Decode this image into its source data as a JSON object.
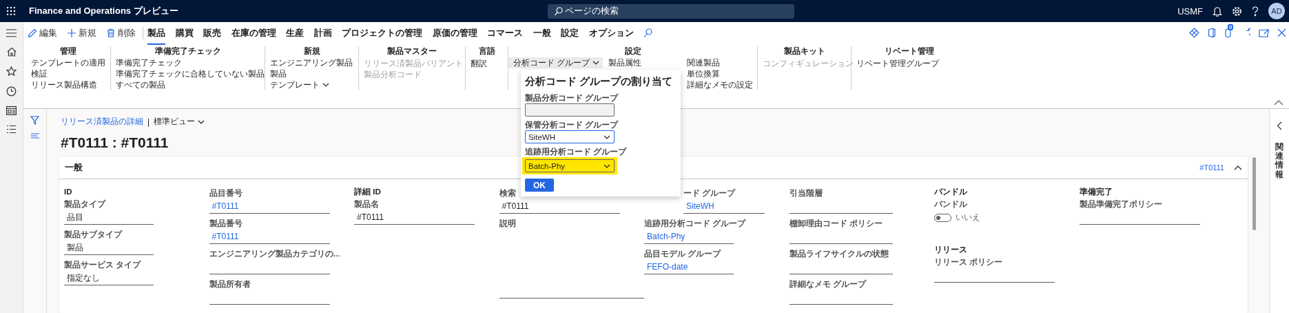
{
  "topbar": {
    "app_title": "Finance and Operations プレビュー",
    "search_placeholder": "ページの検索",
    "company": "USMF",
    "avatar": "AD"
  },
  "actions": [
    {
      "label": "編集",
      "kind": "edit"
    },
    {
      "label": "新規",
      "kind": "new"
    },
    {
      "label": "削除",
      "kind": "delete"
    }
  ],
  "tabs": [
    {
      "label": "製品",
      "selected": true
    },
    {
      "label": "購買",
      "selected": false
    },
    {
      "label": "販売",
      "selected": false
    },
    {
      "label": "在庫の管理",
      "selected": false
    },
    {
      "label": "生産",
      "selected": false
    },
    {
      "label": "計画",
      "selected": false
    },
    {
      "label": "プロジェクトの管理",
      "selected": false
    },
    {
      "label": "原価の管理",
      "selected": false
    },
    {
      "label": "コマース",
      "selected": false
    },
    {
      "label": "一般",
      "selected": false
    },
    {
      "label": "設定",
      "selected": false
    },
    {
      "label": "オプション",
      "selected": false
    }
  ],
  "attachments_badge": "0",
  "ribbon_groups": [
    {
      "title": "管理",
      "columns": [
        [
          {
            "label": "テンプレートの適用",
            "kind": "button",
            "disabled": false
          },
          {
            "label": "検証",
            "kind": "button",
            "disabled": false
          },
          {
            "label": "リリース製品構造",
            "kind": "button",
            "disabled": false
          }
        ]
      ]
    },
    {
      "title": "準備完了チェック",
      "columns": [
        [
          {
            "label": "準備完了チェック",
            "kind": "button",
            "disabled": false
          },
          {
            "label": "準備完了チェックに合格していない製品",
            "kind": "button",
            "disabled": false
          },
          {
            "label": "すべての製品",
            "kind": "button",
            "disabled": false
          }
        ]
      ]
    },
    {
      "title": "新規",
      "columns": [
        [
          {
            "label": "エンジニアリング製品",
            "kind": "button",
            "disabled": false
          },
          {
            "label": "製品",
            "kind": "button",
            "disabled": false
          },
          {
            "label": "テンプレート",
            "kind": "dropdown",
            "disabled": false,
            "expanded": false
          }
        ]
      ]
    },
    {
      "title": "製品マスター",
      "columns": [
        [
          {
            "label": "リリース済製品バリアント",
            "kind": "button",
            "disabled": true
          },
          {
            "label": "製品分析コード",
            "kind": "button",
            "disabled": true
          }
        ]
      ]
    },
    {
      "title": "言語",
      "columns": [
        [
          {
            "label": "翻訳",
            "kind": "button",
            "disabled": false
          }
        ]
      ]
    },
    {
      "title": "設定",
      "columns": [
        [
          {
            "label": "分析コード グループ",
            "kind": "dropdown",
            "disabled": false,
            "expanded": true
          }
        ],
        [
          {
            "label": "製品属性",
            "kind": "button",
            "disabled": false
          }
        ],
        [
          {
            "label": "関連製品",
            "kind": "button",
            "disabled": false
          },
          {
            "label": "単位換算",
            "kind": "button",
            "disabled": false
          },
          {
            "label": "詳細なメモの設定",
            "kind": "button",
            "disabled": false
          }
        ]
      ]
    },
    {
      "title": "製品キット",
      "columns": [
        [
          {
            "label": "コンフィギュレーション",
            "kind": "button",
            "disabled": true
          }
        ]
      ]
    },
    {
      "title": "リベート管理",
      "columns": [
        [
          {
            "label": "リベート管理グループ",
            "kind": "button",
            "disabled": false
          }
        ]
      ]
    }
  ],
  "breadcrumb": {
    "link": "リリース済製品の詳細",
    "separator": "|",
    "view": "標準ビュー"
  },
  "page_title": "#T0111 : #T0111",
  "card": {
    "title": "一般",
    "summary": "#T0111",
    "expanded": true,
    "columns": [
      [
        {
          "kind": "header",
          "label": "ID"
        },
        {
          "kind": "field",
          "label": "製品タイプ",
          "value": "品目",
          "link": false
        },
        {
          "kind": "field",
          "label": "製品サブタイプ",
          "value": "製品",
          "link": false
        },
        {
          "kind": "field",
          "label": "製品サービス タイプ",
          "value": "指定なし",
          "link": false
        }
      ],
      [
        {
          "kind": "field",
          "label": "品目番号",
          "value": "#T0111",
          "link": true
        },
        {
          "kind": "field",
          "label": "製品番号",
          "value": "#T0111",
          "link": true
        },
        {
          "kind": "field",
          "label": "エンジニアリング製品カテゴリの...",
          "link": false
        },
        {
          "kind": "field",
          "label": "製品所有者",
          "link": false
        }
      ],
      [
        {
          "kind": "header",
          "label": "詳細 ID"
        },
        {
          "kind": "field",
          "label": "製品名",
          "value": "#T0111",
          "link": false
        }
      ],
      [
        {
          "kind": "field",
          "label": "検索",
          "value": "#T0111",
          "link": false
        },
        {
          "kind": "multiline",
          "label": "説明"
        }
      ],
      [
        {
          "kind": "field",
          "label": "ード グループ",
          "value": "SiteWH",
          "link": true
        },
        {
          "kind": "field",
          "label": "追跡用分析コード グループ",
          "value": "Batch-Phy",
          "link": true
        },
        {
          "kind": "field",
          "label": "品目モデル グループ",
          "value": "FEFO-date",
          "link": true
        }
      ],
      [
        {
          "kind": "field",
          "label": "引当階層",
          "link": false
        },
        {
          "kind": "field",
          "label": "棚卸理由コード ポリシー",
          "link": false
        },
        {
          "kind": "field",
          "label": "製品ライフサイクルの状態",
          "link": false
        },
        {
          "kind": "field",
          "label": "詳細なメモ グループ",
          "link": false
        }
      ],
      [
        {
          "kind": "header",
          "label": "バンドル"
        },
        {
          "kind": "toggle",
          "label": "バンドル",
          "on": false,
          "value": "いいえ"
        },
        {
          "kind": "header",
          "label": "リリース"
        },
        {
          "kind": "field",
          "label": "リリース ポリシー",
          "link": false
        }
      ],
      [
        {
          "kind": "header",
          "label": "準備完了"
        },
        {
          "kind": "field",
          "label": "製品準備完了ポリシー",
          "link": false
        }
      ]
    ]
  },
  "related_pane": "関連情報",
  "popup": {
    "title": "分析コード グループの割り当て",
    "fields": [
      {
        "label": "製品分析コード グループ",
        "kind": "text",
        "disabled": true,
        "focused": false,
        "highlighted": false
      },
      {
        "label": "保管分析コード グループ",
        "kind": "combo",
        "value": "SiteWH",
        "disabled": false,
        "focused": true,
        "highlighted": false
      },
      {
        "label": "追跡用分析コード グループ",
        "kind": "combo",
        "value": "Batch-Phy",
        "disabled": false,
        "focused": false,
        "highlighted": true
      }
    ],
    "ok": "OK"
  }
}
